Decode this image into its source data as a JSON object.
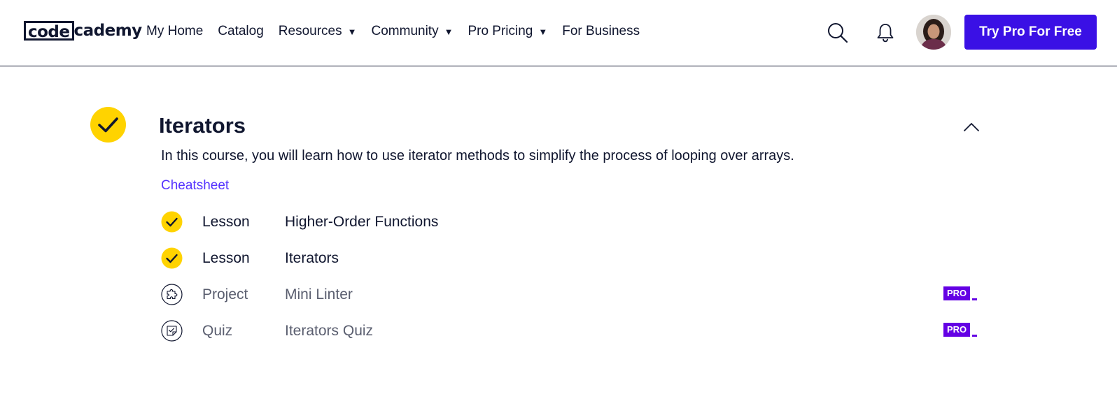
{
  "header": {
    "logo": {
      "boxed": "code",
      "rest": "cademy"
    },
    "nav": [
      {
        "label": "My Home",
        "dropdown": false
      },
      {
        "label": "Catalog",
        "dropdown": false
      },
      {
        "label": "Resources",
        "dropdown": true
      },
      {
        "label": "Community",
        "dropdown": true
      },
      {
        "label": "Pro Pricing",
        "dropdown": true
      },
      {
        "label": "For Business",
        "dropdown": false
      }
    ],
    "caret_glyph": "▼",
    "icons": {
      "search": "search-icon",
      "notifications": "bell-icon",
      "avatar": "user-avatar"
    },
    "cta_label": "Try Pro For Free"
  },
  "module": {
    "title": "Iterators",
    "completed": true,
    "description": "In this course, you will learn how to use iterator methods to simplify the process of looping over arrays.",
    "cheatsheet_label": "Cheatsheet",
    "expanded": true,
    "items": [
      {
        "type": "Lesson",
        "name": "Higher-Order Functions",
        "status": "completed",
        "icon": "check-icon",
        "pro": false
      },
      {
        "type": "Lesson",
        "name": "Iterators",
        "status": "completed",
        "icon": "check-icon",
        "pro": false
      },
      {
        "type": "Project",
        "name": "Mini Linter",
        "status": "not-started",
        "icon": "puzzle-icon",
        "pro": true
      },
      {
        "type": "Quiz",
        "name": "Iterators Quiz",
        "status": "not-started",
        "icon": "quiz-icon",
        "pro": true
      }
    ],
    "pro_label": "PRO"
  },
  "colors": {
    "brand_navy": "#10162f",
    "cta_blue": "#3a10e5",
    "check_yellow": "#ffd300",
    "link_purple": "#5533ff",
    "pro_purple": "#6400e4",
    "muted_text": "#5a5e6f"
  }
}
